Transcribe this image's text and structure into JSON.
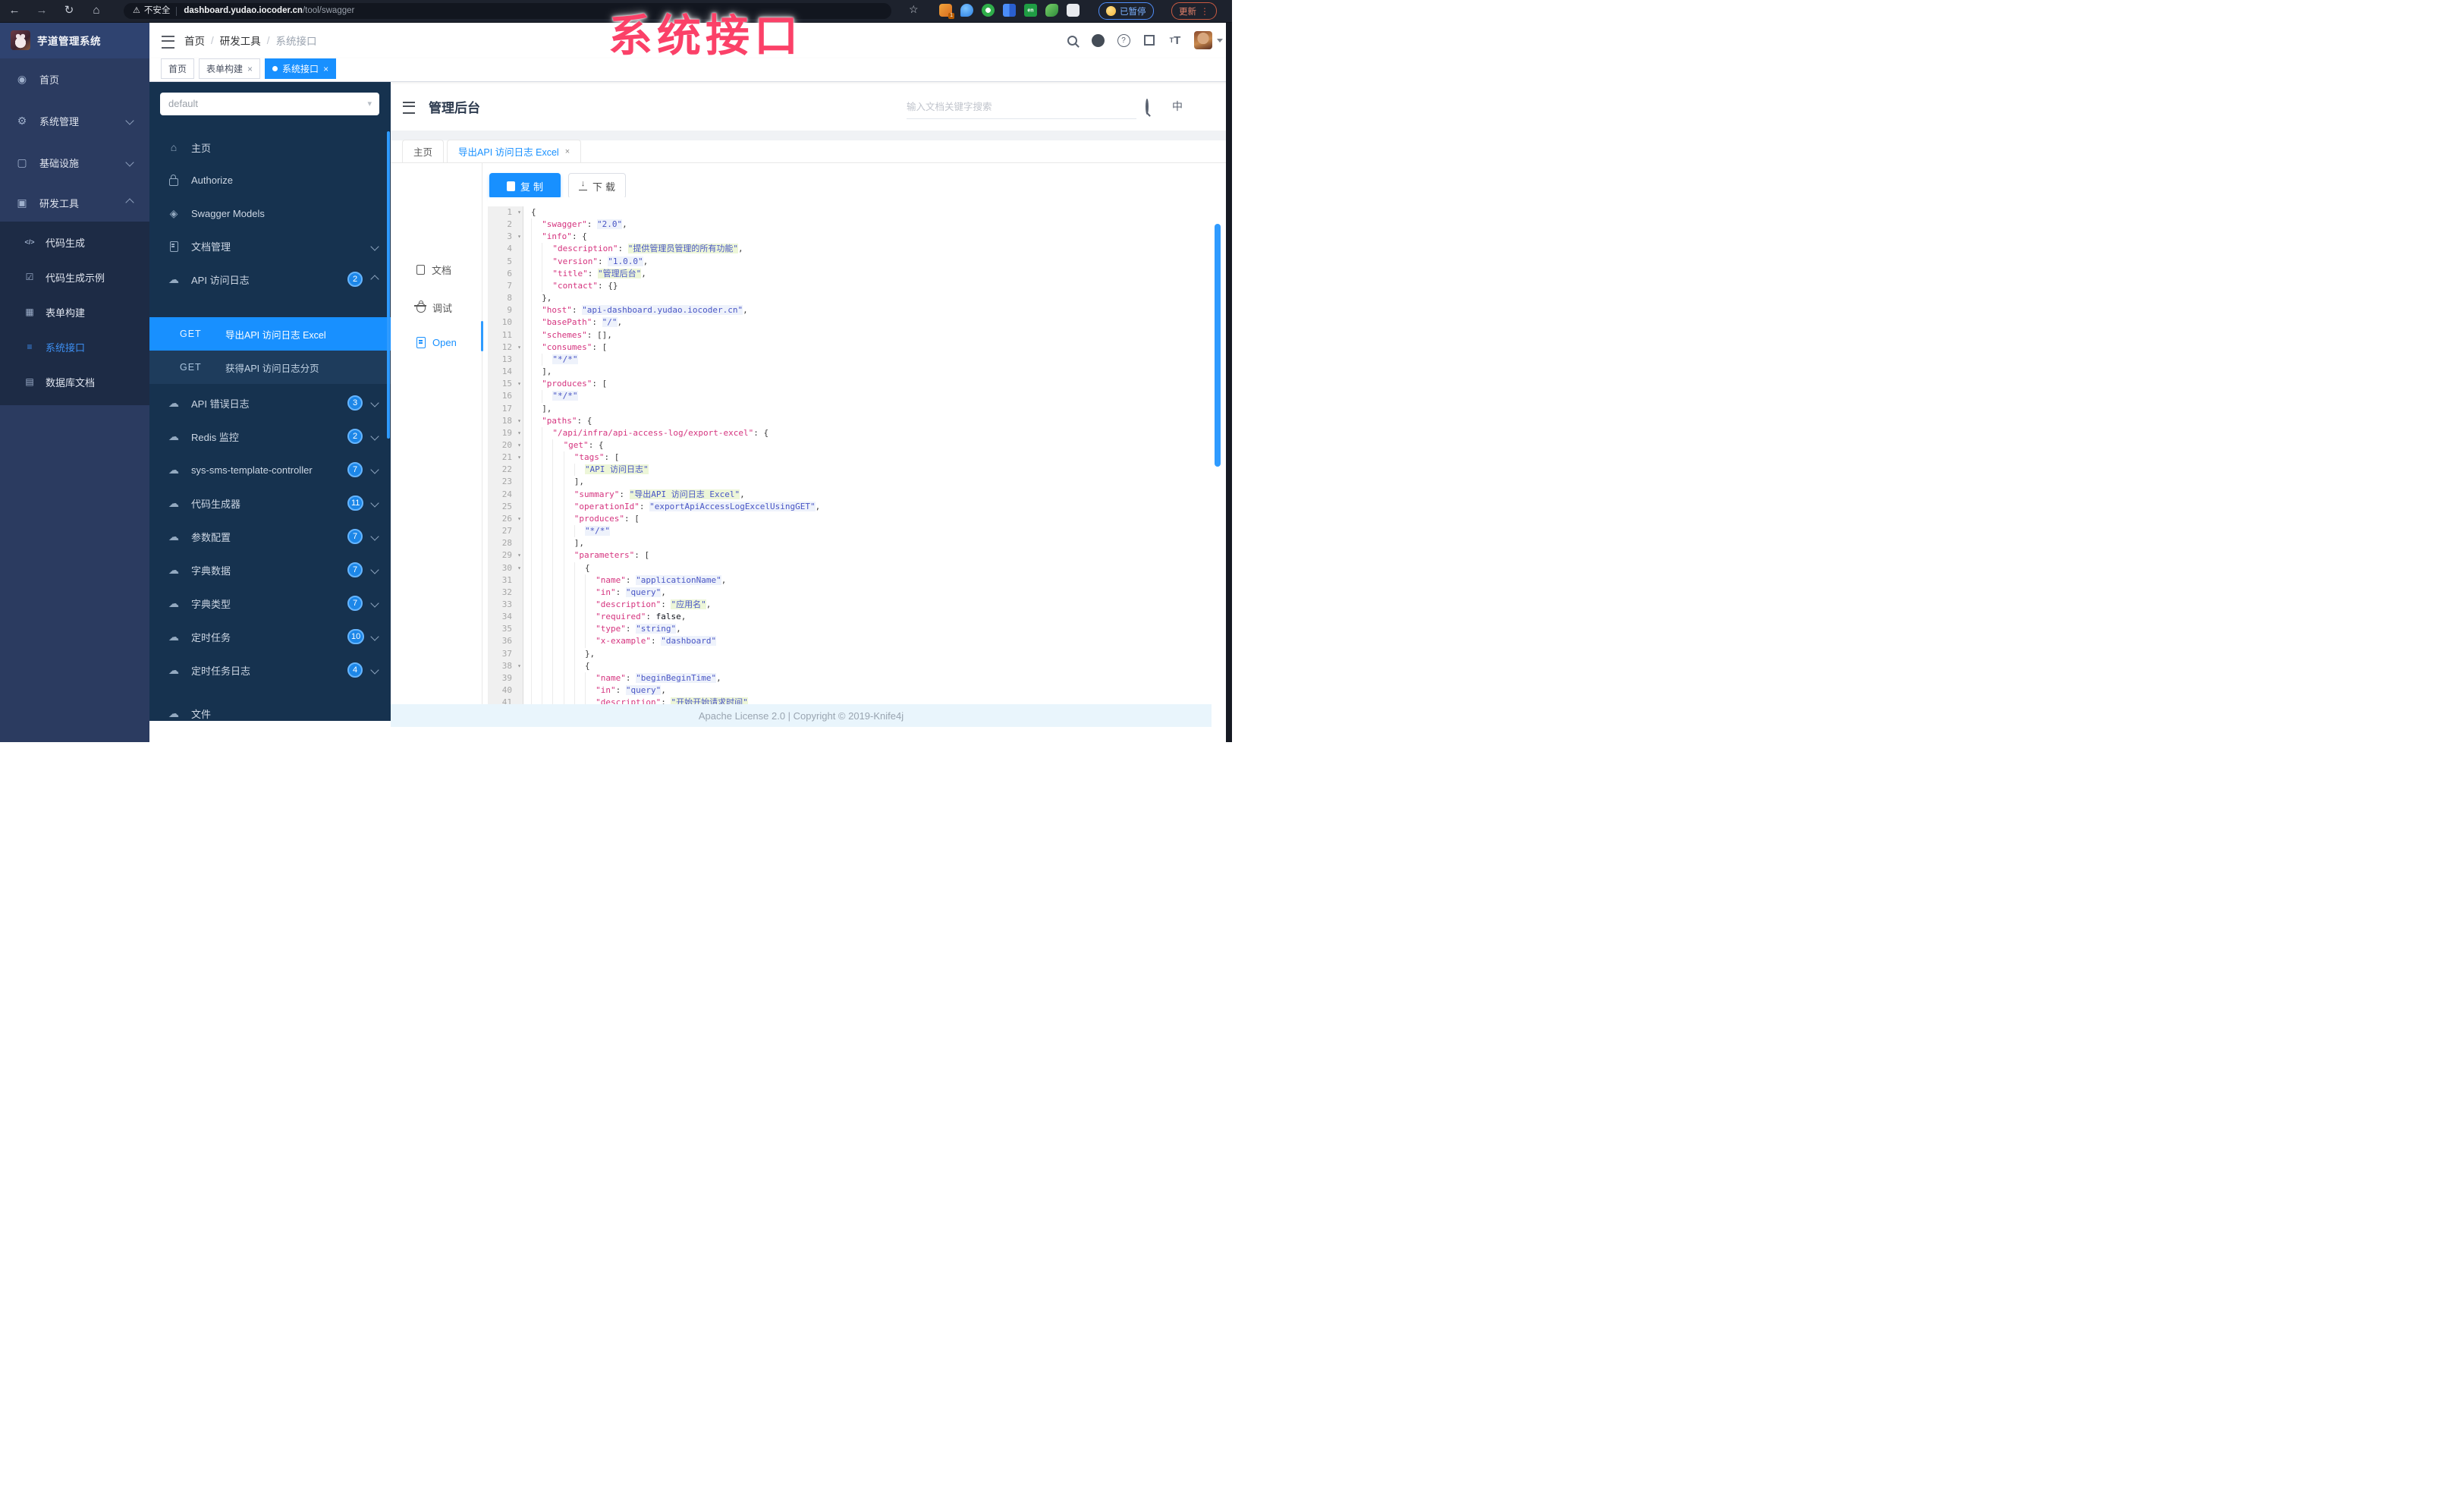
{
  "browser": {
    "security_label": "不安全",
    "url_host": "dashboard.yudao.iocoder.cn",
    "url_path": "/tool/swagger",
    "paused_label": "已暂停",
    "update_label": "更新",
    "extensions": [
      {
        "name": "orange-extension-icon",
        "style": "orange",
        "badge": "1"
      },
      {
        "name": "blue-drop-extension-icon",
        "style": "bluedrop",
        "badge": ""
      },
      {
        "name": "green-check-extension-icon",
        "style": "greencheck",
        "badge": ""
      },
      {
        "name": "blue-grid-extension-icon",
        "style": "bluegrid",
        "badge": ""
      },
      {
        "name": "translator-extension-icon",
        "style": "dark-en",
        "badge": "en"
      },
      {
        "name": "green-leaf-extension-icon",
        "style": "greenleaf",
        "badge": ""
      },
      {
        "name": "white-puzzle-extension-icon",
        "style": "whitepuzzle",
        "badge": ""
      }
    ]
  },
  "watermark": "系统接口",
  "app_sidebar": {
    "logo_title": "芋道管理系统",
    "items": [
      {
        "label": "首页",
        "icon": "gauge-icon",
        "glyph": "◉",
        "chevron": ""
      },
      {
        "label": "系统管理",
        "icon": "gear-icon",
        "glyph": "⚙",
        "chevron": "down"
      },
      {
        "label": "基础设施",
        "icon": "monitor-icon",
        "glyph": "▢",
        "chevron": "down"
      },
      {
        "label": "研发工具",
        "icon": "toolbox-icon",
        "glyph": "▣",
        "chevron": "up"
      }
    ],
    "sub_items": [
      {
        "label": "代码生成",
        "icon": "code-icon",
        "glyph": "</>",
        "active": false
      },
      {
        "label": "代码生成示例",
        "icon": "shield-check-icon",
        "glyph": "☑",
        "active": false
      },
      {
        "label": "表单构建",
        "icon": "form-grid-icon",
        "glyph": "▦",
        "active": false
      },
      {
        "label": "系统接口",
        "icon": "swagger-icon",
        "glyph": "≡",
        "active": true
      },
      {
        "label": "数据库文档",
        "icon": "database-icon",
        "glyph": "▤",
        "active": false
      }
    ]
  },
  "header": {
    "breadcrumb": [
      "首页",
      "研发工具",
      "系统接口"
    ]
  },
  "page_tabs": [
    {
      "label": "首页",
      "closable": false,
      "active": false
    },
    {
      "label": "表单构建",
      "closable": true,
      "active": false
    },
    {
      "label": "系统接口",
      "closable": true,
      "active": true
    }
  ],
  "swagger_sidebar": {
    "select_value": "default",
    "items": [
      {
        "type": "item",
        "icon": "home-icon",
        "glyph": "⌂",
        "label": "主页",
        "badge": "",
        "chevron": ""
      },
      {
        "type": "item",
        "icon": "lock-icon",
        "glyph": "",
        "label": "Authorize",
        "badge": "",
        "chevron": ""
      },
      {
        "type": "item",
        "icon": "models-icon",
        "glyph": "◈",
        "label": "Swagger Models",
        "badge": "",
        "chevron": ""
      },
      {
        "type": "item",
        "icon": "document-icon",
        "glyph": "",
        "label": "文档管理",
        "badge": "",
        "chevron": "down"
      },
      {
        "type": "item",
        "icon": "cloud-api-icon",
        "glyph": "☁",
        "label": "API 访问日志",
        "badge": "2",
        "chevron": "up"
      },
      {
        "type": "get",
        "method": "GET",
        "label": "导出API 访问日志 Excel",
        "active": true
      },
      {
        "type": "get",
        "method": "GET",
        "label": "获得API 访问日志分页",
        "active": false
      },
      {
        "type": "item",
        "icon": "cloud-api-icon",
        "glyph": "☁",
        "label": "API 错误日志",
        "badge": "3",
        "chevron": "down"
      },
      {
        "type": "item",
        "icon": "cloud-api-icon",
        "glyph": "☁",
        "label": "Redis 监控",
        "badge": "2",
        "chevron": "down"
      },
      {
        "type": "item",
        "icon": "cloud-api-icon",
        "glyph": "☁",
        "label": "sys-sms-template-controller",
        "badge": "7",
        "chevron": "down"
      },
      {
        "type": "item",
        "icon": "cloud-api-icon",
        "glyph": "☁",
        "label": "代码生成器",
        "badge": "11",
        "chevron": "down"
      },
      {
        "type": "item",
        "icon": "cloud-api-icon",
        "glyph": "☁",
        "label": "参数配置",
        "badge": "7",
        "chevron": "down"
      },
      {
        "type": "item",
        "icon": "cloud-api-icon",
        "glyph": "☁",
        "label": "字典数据",
        "badge": "7",
        "chevron": "down"
      },
      {
        "type": "item",
        "icon": "cloud-api-icon",
        "glyph": "☁",
        "label": "字典类型",
        "badge": "7",
        "chevron": "down"
      },
      {
        "type": "item",
        "icon": "cloud-api-icon",
        "glyph": "☁",
        "label": "定时任务",
        "badge": "10",
        "chevron": "down"
      },
      {
        "type": "item",
        "icon": "cloud-api-icon",
        "glyph": "☁",
        "label": "定时任务日志",
        "badge": "4",
        "chevron": "down"
      },
      {
        "type": "item",
        "icon": "cloud-api-icon",
        "glyph": "☁",
        "label": "文件",
        "badge": "",
        "chevron": "",
        "clipped": true
      }
    ]
  },
  "main": {
    "title": "管理后台",
    "search_placeholder": "输入文档关键字搜索",
    "lang_label": "中",
    "doc_tabs": [
      {
        "label": "主页",
        "closable": false,
        "active": false
      },
      {
        "label": "导出API 访问日志 Excel",
        "closable": true,
        "active": true
      }
    ],
    "side_tabs": [
      {
        "label": "文档",
        "icon": "doc-copy-icon",
        "active": false
      },
      {
        "label": "调试",
        "icon": "bug-icon",
        "active": false
      },
      {
        "label": "Open",
        "icon": "file-icon",
        "active": true
      }
    ],
    "copy_label": "复制",
    "download_label": "下载"
  },
  "editor": {
    "lines": [
      {
        "n": 1,
        "i": 0,
        "fold": true,
        "t": [
          [
            "p",
            "{"
          ]
        ]
      },
      {
        "n": 2,
        "i": 1,
        "fold": false,
        "t": [
          [
            "k",
            "\"swagger\""
          ],
          [
            "p",
            ": "
          ],
          [
            "s",
            "\"2.0\""
          ],
          [
            "p",
            ","
          ]
        ]
      },
      {
        "n": 3,
        "i": 1,
        "fold": true,
        "t": [
          [
            "k",
            "\"info\""
          ],
          [
            "p",
            ": {"
          ]
        ]
      },
      {
        "n": 4,
        "i": 2,
        "fold": false,
        "t": [
          [
            "k",
            "\"description\""
          ],
          [
            "p",
            ": "
          ],
          [
            "sh",
            "\"提供管理员管理的所有功能\""
          ],
          [
            "p",
            ","
          ]
        ]
      },
      {
        "n": 5,
        "i": 2,
        "fold": false,
        "t": [
          [
            "k",
            "\"version\""
          ],
          [
            "p",
            ": "
          ],
          [
            "s",
            "\"1.0.0\""
          ],
          [
            "p",
            ","
          ]
        ]
      },
      {
        "n": 6,
        "i": 2,
        "fold": false,
        "t": [
          [
            "k",
            "\"title\""
          ],
          [
            "p",
            ": "
          ],
          [
            "sh",
            "\"管理后台\""
          ],
          [
            "p",
            ","
          ]
        ]
      },
      {
        "n": 7,
        "i": 2,
        "fold": false,
        "t": [
          [
            "k",
            "\"contact\""
          ],
          [
            "p",
            ": {}"
          ]
        ]
      },
      {
        "n": 8,
        "i": 1,
        "fold": false,
        "t": [
          [
            "p",
            "},"
          ]
        ]
      },
      {
        "n": 9,
        "i": 1,
        "fold": false,
        "t": [
          [
            "k",
            "\"host\""
          ],
          [
            "p",
            ": "
          ],
          [
            "s",
            "\"api-dashboard.yudao.iocoder.cn\""
          ],
          [
            "p",
            ","
          ]
        ]
      },
      {
        "n": 10,
        "i": 1,
        "fold": false,
        "t": [
          [
            "k",
            "\"basePath\""
          ],
          [
            "p",
            ": "
          ],
          [
            "s",
            "\"/\""
          ],
          [
            "p",
            ","
          ]
        ]
      },
      {
        "n": 11,
        "i": 1,
        "fold": false,
        "t": [
          [
            "k",
            "\"schemes\""
          ],
          [
            "p",
            ": [],"
          ]
        ]
      },
      {
        "n": 12,
        "i": 1,
        "fold": true,
        "t": [
          [
            "k",
            "\"consumes\""
          ],
          [
            "p",
            ": ["
          ]
        ]
      },
      {
        "n": 13,
        "i": 2,
        "fold": false,
        "t": [
          [
            "s",
            "\"*/*\""
          ]
        ]
      },
      {
        "n": 14,
        "i": 1,
        "fold": false,
        "t": [
          [
            "p",
            "],"
          ]
        ]
      },
      {
        "n": 15,
        "i": 1,
        "fold": true,
        "t": [
          [
            "k",
            "\"produces\""
          ],
          [
            "p",
            ": ["
          ]
        ]
      },
      {
        "n": 16,
        "i": 2,
        "fold": false,
        "t": [
          [
            "s",
            "\"*/*\""
          ]
        ]
      },
      {
        "n": 17,
        "i": 1,
        "fold": false,
        "t": [
          [
            "p",
            "],"
          ]
        ]
      },
      {
        "n": 18,
        "i": 1,
        "fold": true,
        "t": [
          [
            "k",
            "\"paths\""
          ],
          [
            "p",
            ": {"
          ]
        ]
      },
      {
        "n": 19,
        "i": 2,
        "fold": true,
        "t": [
          [
            "k",
            "\"/api/infra/api-access-log/export-excel\""
          ],
          [
            "p",
            ": {"
          ]
        ]
      },
      {
        "n": 20,
        "i": 3,
        "fold": true,
        "t": [
          [
            "k",
            "\"get\""
          ],
          [
            "p",
            ": {"
          ]
        ]
      },
      {
        "n": 21,
        "i": 4,
        "fold": true,
        "t": [
          [
            "k",
            "\"tags\""
          ],
          [
            "p",
            ": ["
          ]
        ]
      },
      {
        "n": 22,
        "i": 5,
        "fold": false,
        "t": [
          [
            "sh",
            "\"API 访问日志\""
          ]
        ]
      },
      {
        "n": 23,
        "i": 4,
        "fold": false,
        "t": [
          [
            "p",
            "],"
          ]
        ]
      },
      {
        "n": 24,
        "i": 4,
        "fold": false,
        "t": [
          [
            "k",
            "\"summary\""
          ],
          [
            "p",
            ": "
          ],
          [
            "sh",
            "\"导出API 访问日志 Excel\""
          ],
          [
            "p",
            ","
          ]
        ]
      },
      {
        "n": 25,
        "i": 4,
        "fold": false,
        "t": [
          [
            "k",
            "\"operationId\""
          ],
          [
            "p",
            ": "
          ],
          [
            "s",
            "\"exportApiAccessLogExcelUsingGET\""
          ],
          [
            "p",
            ","
          ]
        ]
      },
      {
        "n": 26,
        "i": 4,
        "fold": true,
        "t": [
          [
            "k",
            "\"produces\""
          ],
          [
            "p",
            ": ["
          ]
        ]
      },
      {
        "n": 27,
        "i": 5,
        "fold": false,
        "t": [
          [
            "s",
            "\"*/*\""
          ]
        ]
      },
      {
        "n": 28,
        "i": 4,
        "fold": false,
        "t": [
          [
            "p",
            "],"
          ]
        ]
      },
      {
        "n": 29,
        "i": 4,
        "fold": true,
        "t": [
          [
            "k",
            "\"parameters\""
          ],
          [
            "p",
            ": ["
          ]
        ]
      },
      {
        "n": 30,
        "i": 5,
        "fold": true,
        "t": [
          [
            "p",
            "{"
          ]
        ]
      },
      {
        "n": 31,
        "i": 6,
        "fold": false,
        "t": [
          [
            "k",
            "\"name\""
          ],
          [
            "p",
            ": "
          ],
          [
            "s",
            "\"applicationName\""
          ],
          [
            "p",
            ","
          ]
        ]
      },
      {
        "n": 32,
        "i": 6,
        "fold": false,
        "t": [
          [
            "k",
            "\"in\""
          ],
          [
            "p",
            ": "
          ],
          [
            "s",
            "\"query\""
          ],
          [
            "p",
            ","
          ]
        ]
      },
      {
        "n": 33,
        "i": 6,
        "fold": false,
        "t": [
          [
            "k",
            "\"description\""
          ],
          [
            "p",
            ": "
          ],
          [
            "sh",
            "\"应用名\""
          ],
          [
            "p",
            ","
          ]
        ]
      },
      {
        "n": 34,
        "i": 6,
        "fold": false,
        "t": [
          [
            "k",
            "\"required\""
          ],
          [
            "p",
            ": "
          ],
          [
            "b",
            "false"
          ],
          [
            "p",
            ","
          ]
        ]
      },
      {
        "n": 35,
        "i": 6,
        "fold": false,
        "t": [
          [
            "k",
            "\"type\""
          ],
          [
            "p",
            ": "
          ],
          [
            "s",
            "\"string\""
          ],
          [
            "p",
            ","
          ]
        ]
      },
      {
        "n": 36,
        "i": 6,
        "fold": false,
        "t": [
          [
            "k",
            "\"x-example\""
          ],
          [
            "p",
            ": "
          ],
          [
            "s",
            "\"dashboard\""
          ]
        ]
      },
      {
        "n": 37,
        "i": 5,
        "fold": false,
        "t": [
          [
            "p",
            "},"
          ]
        ]
      },
      {
        "n": 38,
        "i": 5,
        "fold": true,
        "t": [
          [
            "p",
            "{"
          ]
        ]
      },
      {
        "n": 39,
        "i": 6,
        "fold": false,
        "t": [
          [
            "k",
            "\"name\""
          ],
          [
            "p",
            ": "
          ],
          [
            "s",
            "\"beginBeginTime\""
          ],
          [
            "p",
            ","
          ]
        ]
      },
      {
        "n": 40,
        "i": 6,
        "fold": false,
        "t": [
          [
            "k",
            "\"in\""
          ],
          [
            "p",
            ": "
          ],
          [
            "s",
            "\"query\""
          ],
          [
            "p",
            ","
          ]
        ]
      },
      {
        "n": 41,
        "i": 6,
        "fold": false,
        "t": [
          [
            "k",
            "\"description\""
          ],
          [
            "p",
            ": "
          ],
          [
            "sh",
            "\"开始开始请求时间\""
          ]
        ]
      }
    ]
  },
  "footer": {
    "text": "Apache License 2.0 | Copyright © 2019-Knife4j"
  },
  "colors": {
    "accent_blue": "#1890ff",
    "sidebar_navy": "#2b3b60",
    "sidebar_sub_navy": "#1d2b45",
    "swagger_sidebar": "#16324f",
    "watermark_pink": "#fb4168",
    "key_color": "#d5347f",
    "string_color": "#4956c5",
    "footer_bg": "#e9f5fc"
  }
}
